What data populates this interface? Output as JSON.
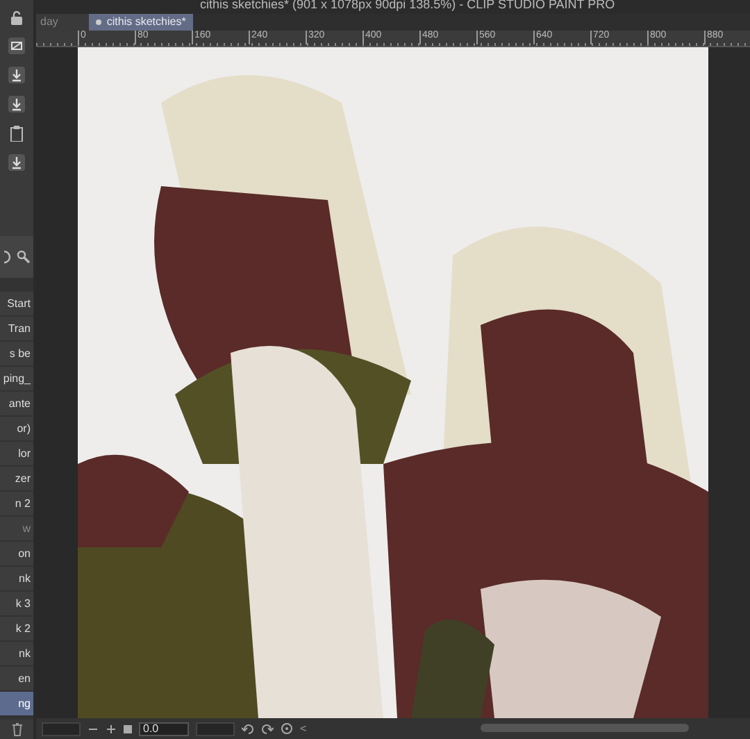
{
  "window": {
    "title": "cithis sketchies* (901 x 1078px 90dpi 138.5%)  - CLIP STUDIO PAINT PRO"
  },
  "tabs": [
    {
      "label": "day",
      "selected": false
    },
    {
      "label": "cithis sketchies*",
      "selected": true
    }
  ],
  "ruler": {
    "ticks": [
      "0",
      "80",
      "160",
      "240",
      "320",
      "400",
      "480",
      "560",
      "640",
      "720",
      "800",
      "880"
    ]
  },
  "layers": [
    {
      "name": "Start",
      "selected": false,
      "hidden": false
    },
    {
      "name": "Tran",
      "selected": false,
      "hidden": false
    },
    {
      "name": "s be",
      "selected": false,
      "hidden": false
    },
    {
      "name": "ping_",
      "selected": false,
      "hidden": false
    },
    {
      "name": "ante",
      "selected": false,
      "hidden": false
    },
    {
      "name": "or)",
      "selected": false,
      "hidden": false
    },
    {
      "name": "lor",
      "selected": false,
      "hidden": false
    },
    {
      "name": "zer",
      "selected": false,
      "hidden": false
    },
    {
      "name": "n 2",
      "selected": false,
      "hidden": false
    },
    {
      "name": "w",
      "selected": false,
      "hidden": true
    },
    {
      "name": "on",
      "selected": false,
      "hidden": false
    },
    {
      "name": "nk",
      "selected": false,
      "hidden": false
    },
    {
      "name": "k 3",
      "selected": false,
      "hidden": false
    },
    {
      "name": "k 2",
      "selected": false,
      "hidden": false
    },
    {
      "name": "nk",
      "selected": false,
      "hidden": false
    },
    {
      "name": "en",
      "selected": false,
      "hidden": false
    },
    {
      "name": "ng",
      "selected": true,
      "hidden": false
    }
  ],
  "bottom_bar": {
    "angle": "0.0",
    "back": "<"
  }
}
